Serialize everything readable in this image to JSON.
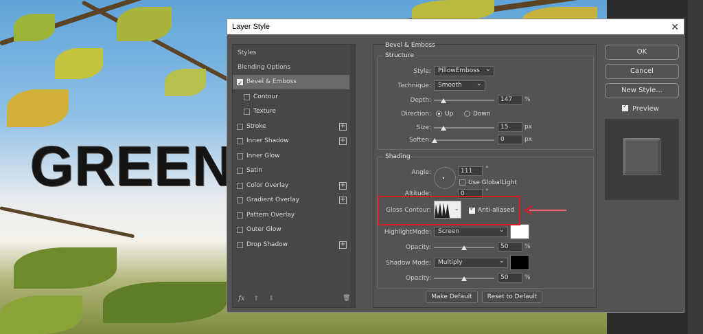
{
  "canvas_text": "GREEN",
  "dialog": {
    "title": "Layer Style",
    "close_glyph": "✕"
  },
  "styles_list": {
    "header_styles": "Styles",
    "header_blending": "Blending Options",
    "items": [
      {
        "label": "Bevel & Emboss",
        "checked": true,
        "selected": true,
        "plus": false,
        "indent": false
      },
      {
        "label": "Contour",
        "checked": false,
        "selected": false,
        "plus": false,
        "indent": true
      },
      {
        "label": "Texture",
        "checked": false,
        "selected": false,
        "plus": false,
        "indent": true
      },
      {
        "label": "Stroke",
        "checked": false,
        "selected": false,
        "plus": true,
        "indent": false
      },
      {
        "label": "Inner Shadow",
        "checked": false,
        "selected": false,
        "plus": true,
        "indent": false
      },
      {
        "label": "Inner Glow",
        "checked": false,
        "selected": false,
        "plus": false,
        "indent": false
      },
      {
        "label": "Satin",
        "checked": false,
        "selected": false,
        "plus": false,
        "indent": false
      },
      {
        "label": "Color Overlay",
        "checked": false,
        "selected": false,
        "plus": true,
        "indent": false
      },
      {
        "label": "Gradient Overlay",
        "checked": false,
        "selected": false,
        "plus": true,
        "indent": false
      },
      {
        "label": "Pattern Overlay",
        "checked": false,
        "selected": false,
        "plus": false,
        "indent": false
      },
      {
        "label": "Outer Glow",
        "checked": false,
        "selected": false,
        "plus": false,
        "indent": false
      },
      {
        "label": "Drop Shadow",
        "checked": false,
        "selected": false,
        "plus": true,
        "indent": false
      }
    ],
    "footer": {
      "fx": "fx",
      "up": "⬆",
      "down": "⬇",
      "trash": "🗑"
    }
  },
  "bevel": {
    "section_title": "Bevel & Emboss",
    "structure": {
      "title": "Structure",
      "style_label": "Style:",
      "style_value": "PillowEmboss",
      "technique_label": "Technique:",
      "technique_value": "Smooth",
      "depth_label": "Depth:",
      "depth_value": "147",
      "depth_unit": "%",
      "direction_label": "Direction:",
      "direction_up": "Up",
      "direction_down": "Down",
      "size_label": "Size:",
      "size_value": "15",
      "size_unit": "px",
      "soften_label": "Soften:",
      "soften_value": "0",
      "soften_unit": "px"
    },
    "shading": {
      "title": "Shading",
      "angle_label": "Angle:",
      "angle_value": "111",
      "angle_unit": "°",
      "global_light_label": "Use GlobalLight",
      "altitude_label": "Altitude:",
      "altitude_value": "0",
      "altitude_unit": "°",
      "gloss_contour_label": "Gloss Contour:",
      "anti_aliased_label": "Anti-aliased",
      "highlight_mode_label": "HighlightMode:",
      "highlight_mode_value": "Screen",
      "highlight_opacity_label": "Opacity:",
      "highlight_opacity_value": "50",
      "highlight_opacity_unit": "%",
      "highlight_color": "#ffffff",
      "shadow_mode_label": "Shadow Mode:",
      "shadow_mode_value": "Multiply",
      "shadow_opacity_label": "Opacity:",
      "shadow_opacity_value": "50",
      "shadow_opacity_unit": "%",
      "shadow_color": "#000000"
    },
    "make_default": "Make Default",
    "reset_default": "Reset to Default"
  },
  "right": {
    "ok": "OK",
    "cancel": "Cancel",
    "new_style": "New Style...",
    "preview_label": "Preview"
  },
  "annotation_color": "#d31f2a"
}
